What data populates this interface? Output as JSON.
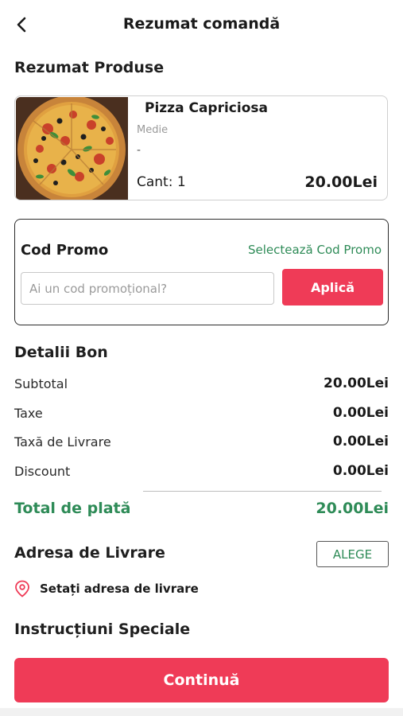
{
  "header": {
    "title": "Rezumat comandă",
    "back_icon": "chevron-left-icon"
  },
  "products_section": {
    "title": "Rezumat Produse",
    "items": [
      {
        "name": "Pizza Capriciosa",
        "size": "Medie",
        "extras": "-",
        "quantity": "Cant: 1",
        "price": "20.00Lei"
      }
    ]
  },
  "promo": {
    "title": "Cod Promo",
    "select_label": "Selectează Cod Promo",
    "input_placeholder": "Ai un cod promoțional?",
    "input_value": "",
    "apply_label": "Aplică"
  },
  "receipt": {
    "title": "Detalii Bon",
    "rows": [
      {
        "label": "Subtotal",
        "value": "20.00Lei"
      },
      {
        "label": "Taxe",
        "value": "0.00Lei"
      },
      {
        "label": "Taxă de Livrare",
        "value": "0.00Lei"
      },
      {
        "label": "Discount",
        "value": "0.00Lei"
      }
    ],
    "total_label": "Total de plată",
    "total_value": "20.00Lei"
  },
  "delivery": {
    "title": "Adresa de Livrare",
    "choose_label": "ALEGE",
    "address_prompt": "Setați adresa de livrare",
    "address_icon": "location-pin-icon"
  },
  "instructions": {
    "title": "Instrucțiuni Speciale"
  },
  "footer": {
    "continue_label": "Continuă"
  },
  "colors": {
    "accent": "#ef3b57",
    "green": "#2e8b57",
    "text": "#1a1a1a",
    "muted": "#9a9a9a"
  }
}
